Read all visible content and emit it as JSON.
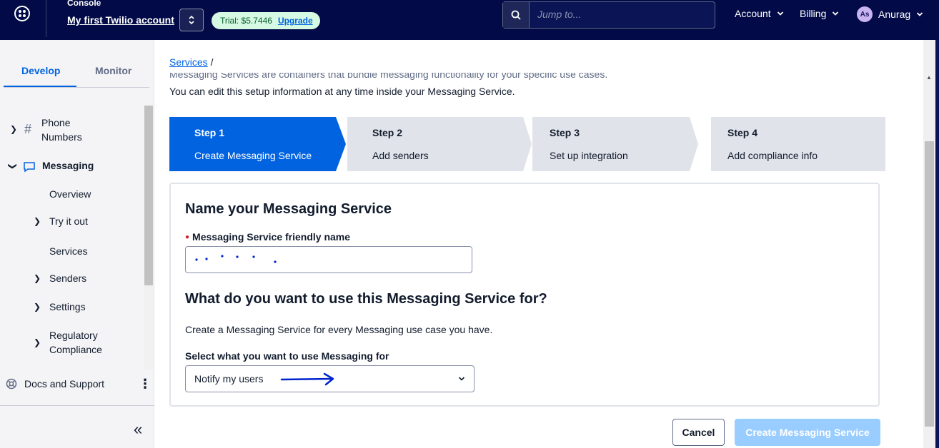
{
  "topbar": {
    "console_label": "Console",
    "account_name": "My first Twilio account",
    "trial_label": "Trial: $5.7446",
    "upgrade_label": "Upgrade",
    "search_placeholder": "Jump to...",
    "account_menu": "Account",
    "billing_menu": "Billing",
    "user_initials": "As",
    "user_name": "Anurag"
  },
  "sidebar": {
    "tabs": [
      "Develop",
      "Monitor"
    ],
    "items": [
      {
        "label": "Phone Numbers",
        "line1": "Phone",
        "line2": "Numbers"
      },
      {
        "label": "Messaging"
      },
      {
        "label": "Overview"
      },
      {
        "label": "Try it out"
      },
      {
        "label": "Services"
      },
      {
        "label": "Senders"
      },
      {
        "label": "Settings"
      },
      {
        "label": "Regulatory Compliance",
        "line1": "Regulatory",
        "line2": "Compliance"
      }
    ],
    "docs_label": "Docs and Support"
  },
  "main": {
    "breadcrumb_link": "Services",
    "breadcrumb_sep": "/",
    "intro_line1": "Messaging Services are containers that bundle messaging functionality for your specific use cases.",
    "intro_line2": "You can edit this setup information at any time inside your Messaging Service.",
    "steps": [
      {
        "num": "Step 1",
        "desc": "Create Messaging Service"
      },
      {
        "num": "Step 2",
        "desc": "Add senders"
      },
      {
        "num": "Step 3",
        "desc": "Set up integration"
      },
      {
        "num": "Step 4",
        "desc": "Add compliance info"
      }
    ],
    "name_heading": "Name your Messaging Service",
    "friendly_name_label": "Messaging Service friendly name",
    "use_heading": "What do you want to use this Messaging Service for?",
    "use_help": "Create a Messaging Service for every Messaging use case you have.",
    "select_label": "Select what you want to use Messaging for",
    "select_value": "Notify my users",
    "cancel_label": "Cancel",
    "create_label": "Create Messaging Service"
  },
  "colors": {
    "topbar_bg": "#020b47",
    "accent": "#0263e0",
    "step_inactive": "#e1e3ea",
    "disabled_button": "#99cdff",
    "annotation": "#0022cc"
  }
}
